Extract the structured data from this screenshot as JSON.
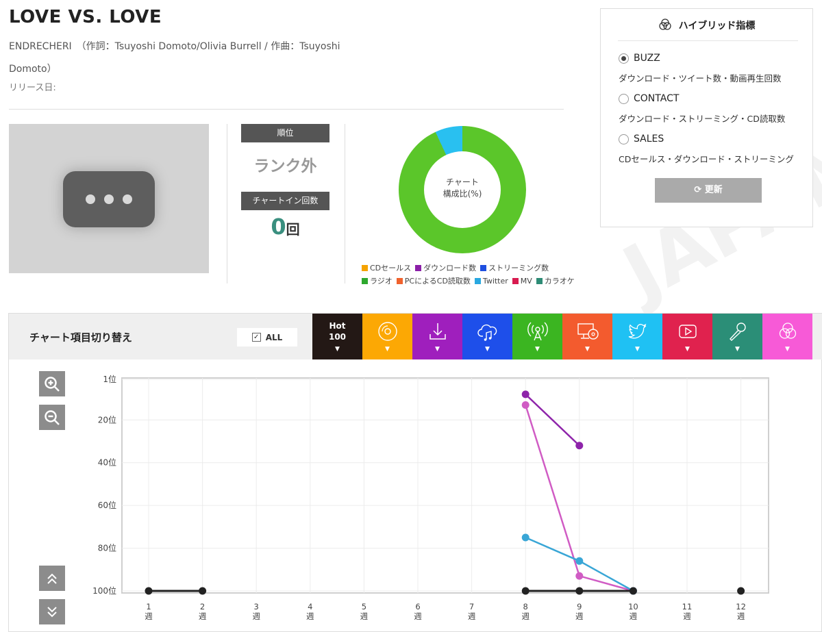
{
  "song": {
    "title": "LOVE VS. LOVE",
    "credits": "ENDRECHERI　（作詞：Tsuyoshi Domoto/Olivia Burrell / 作曲：Tsuyoshi Domoto）",
    "release_label": "リリース日:"
  },
  "artwork": {
    "icon": "more-horizontal-icon"
  },
  "rank": {
    "label": "順位",
    "value": "ランク外"
  },
  "chart_in": {
    "label": "チャートイン回数",
    "value": "0",
    "unit": "回"
  },
  "composition": {
    "center_label_1": "チャート",
    "center_label_2": "構成比(%)",
    "legend_row1": [
      {
        "label": "CDセールス",
        "color": "#f5a300"
      },
      {
        "label": "ダウンロード数",
        "color": "#8b1fa8"
      },
      {
        "label": "ストリーミング数",
        "color": "#1e4fe0"
      }
    ],
    "legend_row2": [
      {
        "label": "ラジオ",
        "color": "#2ea82e"
      },
      {
        "label": "PCによるCD読取数",
        "color": "#f0622d"
      },
      {
        "label": "Twitter",
        "color": "#29a8e0"
      },
      {
        "label": "MV",
        "color": "#d81b50"
      },
      {
        "label": "カラオケ",
        "color": "#2e8c76"
      }
    ],
    "slices": [
      {
        "name": "ラジオ",
        "percent": 93,
        "color": "#5bc62a"
      },
      {
        "name": "Twitter",
        "percent": 7,
        "color": "#29c0f0"
      }
    ]
  },
  "hybrid": {
    "title": "ハイブリッド指標",
    "options": [
      {
        "name": "BUZZ",
        "desc": "ダウンロード・ツイート数・動画再生回数",
        "selected": true
      },
      {
        "name": "CONTACT",
        "desc": "ダウンロード・ストリーミング・CD読取数",
        "selected": false
      },
      {
        "name": "SALES",
        "desc": "CDセールス・ダウンロード・ストリーミング",
        "selected": false
      }
    ],
    "refresh_label": "更新"
  },
  "switcher": {
    "title": "チャート項目切り替え",
    "all_label": "ALL",
    "hot_line1": "Hot",
    "hot_line2": "100",
    "categories": [
      {
        "name": "hot100",
        "color": "#231815",
        "icon": "hot-100"
      },
      {
        "name": "cd",
        "color": "#fca804",
        "icon": "cd-icon"
      },
      {
        "name": "download",
        "color": "#9f1fbd",
        "icon": "download-icon"
      },
      {
        "name": "streaming",
        "color": "#1e4fea",
        "icon": "cloud-music-icon"
      },
      {
        "name": "radio",
        "color": "#3bb521",
        "icon": "radio-icon"
      },
      {
        "name": "pc-cd",
        "color": "#f35b2e",
        "icon": "pc-cd-icon"
      },
      {
        "name": "twitter",
        "color": "#1fc1f3",
        "icon": "twitter-icon"
      },
      {
        "name": "mv",
        "color": "#e0224e",
        "icon": "play-icon"
      },
      {
        "name": "karaoke",
        "color": "#2b8e77",
        "icon": "microphone-icon"
      },
      {
        "name": "hybrid",
        "color": "#f75ad7",
        "icon": "hybrid-icon"
      }
    ]
  },
  "chart_data": {
    "type": "line",
    "y_inverted": true,
    "ylim": [
      1,
      100
    ],
    "y_ticks": [
      "1位",
      "20位",
      "40位",
      "60位",
      "80位",
      "100位"
    ],
    "y_tick_values": [
      1,
      20,
      40,
      60,
      80,
      100
    ],
    "x_ticks": [
      "1",
      "2",
      "3",
      "4",
      "5",
      "6",
      "7",
      "8",
      "9",
      "10",
      "11",
      "12"
    ],
    "x_tick_unit": "週",
    "grid": true,
    "series": [
      {
        "color": "#8e24aa",
        "points": [
          [
            8,
            8
          ],
          [
            9,
            32
          ]
        ]
      },
      {
        "color": "#d05cc4",
        "points": [
          [
            8,
            13
          ],
          [
            9,
            93
          ],
          [
            10,
            100
          ]
        ]
      },
      {
        "color": "#39a6d6",
        "points": [
          [
            8,
            75
          ],
          [
            9,
            86
          ],
          [
            10,
            100
          ]
        ]
      },
      {
        "color": "#222222",
        "points": [
          [
            1,
            100
          ],
          [
            2,
            100
          ]
        ]
      },
      {
        "color": "#222222",
        "points": [
          [
            8,
            100
          ],
          [
            9,
            100
          ],
          [
            10,
            100
          ]
        ]
      },
      {
        "color": "#222222",
        "points": [
          [
            12,
            100
          ]
        ]
      }
    ]
  }
}
